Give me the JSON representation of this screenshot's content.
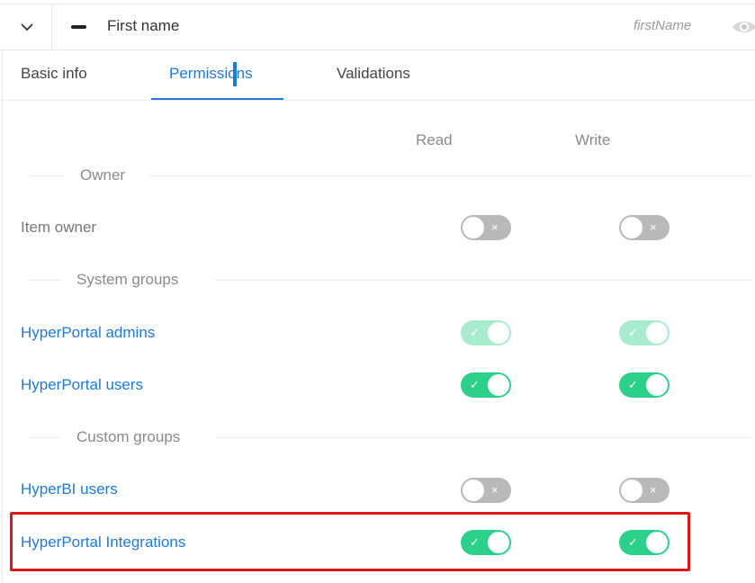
{
  "header": {
    "field_label": "First name",
    "field_key": "firstName",
    "icons": {
      "collapse": "chevron-down-icon",
      "drag": "minus-icon",
      "visibility": "eye-icon"
    }
  },
  "tabs": [
    {
      "label": "Basic info",
      "active": false
    },
    {
      "label": "Permissions",
      "active": true
    },
    {
      "label": "Validations",
      "active": false
    }
  ],
  "columns": {
    "read": "Read",
    "write": "Write"
  },
  "groups": {
    "owner": "Owner",
    "system": "System groups",
    "custom": "Custom groups"
  },
  "rows": {
    "item_owner": {
      "label": "Item owner",
      "read": false,
      "write": false
    },
    "hp_admins": {
      "label": "HyperPortal admins",
      "read": true,
      "write": true,
      "disabled": true
    },
    "hp_users": {
      "label": "HyperPortal users",
      "read": true,
      "write": true
    },
    "hbi_users": {
      "label": "HyperBI users",
      "read": false,
      "write": false
    },
    "hp_integrations": {
      "label": "HyperPortal Integrations",
      "read": true,
      "write": true
    }
  },
  "colors": {
    "accent": "#1f7ad6",
    "toggle_on": "#2bd18a",
    "toggle_off": "#b9b9b9",
    "highlight": "#e01515"
  },
  "toggle_marks": {
    "on": "✓",
    "off": "×"
  }
}
